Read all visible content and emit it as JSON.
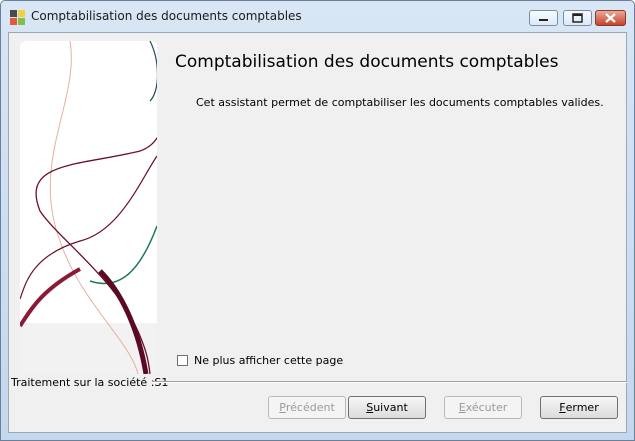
{
  "window": {
    "title": "Comptabilisation des documents comptables"
  },
  "page": {
    "heading": "Comptabilisation des documents comptables",
    "description": "Cet assistant permet de comptabiliser les documents comptables valides."
  },
  "checkbox": {
    "label": "Ne plus afficher cette page",
    "checked": false
  },
  "status": {
    "text": "Traitement sur la société :S1"
  },
  "buttons": {
    "previous": {
      "mnemonic": "P",
      "rest": "récédent",
      "enabled": false
    },
    "next": {
      "mnemonic": "S",
      "rest": "uivant",
      "enabled": true
    },
    "execute": {
      "mnemonic": "E",
      "rest": "xécuter",
      "enabled": false
    },
    "close": {
      "mnemonic": "F",
      "rest": "ermer",
      "enabled": true
    }
  },
  "colors": {
    "curve_dark_red": "#6b0f2a",
    "curve_green": "#1e7a55",
    "curve_light": "#e5b0a0"
  }
}
